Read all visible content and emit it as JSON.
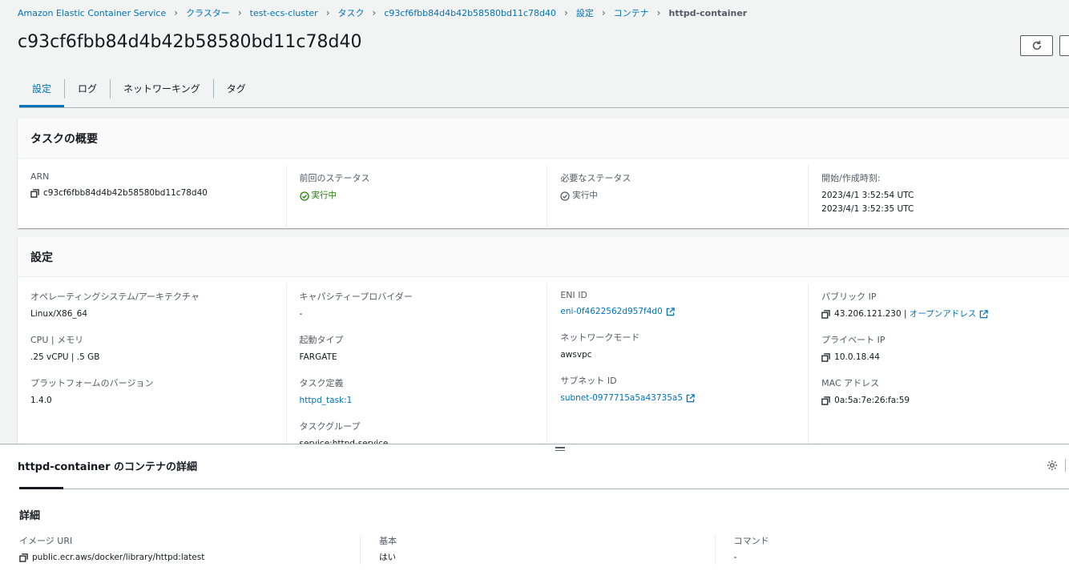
{
  "breadcrumb": {
    "items": [
      "Amazon Elastic Container Service",
      "クラスター",
      "test-ecs-cluster",
      "タスク",
      "c93cf6fbb84d4b42b58580bd11c78d40",
      "設定",
      "コンテナ"
    ],
    "current": "httpd-container"
  },
  "header": {
    "title": "c93cf6fbb84d4b42b58580bd11c78d40"
  },
  "tabs": [
    {
      "label": "設定",
      "active": true
    },
    {
      "label": "ログ"
    },
    {
      "label": "ネットワーキング"
    },
    {
      "label": "タグ"
    }
  ],
  "task_overview": {
    "title": "タスクの概要",
    "arn": {
      "label": "ARN",
      "value": "c93cf6fbb84d4b42b58580bd11c78d40"
    },
    "last_status": {
      "label": "前回のステータス",
      "value": "実行中"
    },
    "desired_status": {
      "label": "必要なステータス",
      "value": "実行中"
    },
    "started_created": {
      "label": "開始/作成時刻:",
      "values": [
        "2023/4/1 3:52:54 UTC",
        "2023/4/1 3:52:35 UTC"
      ]
    }
  },
  "config": {
    "title": "設定",
    "os_arch": {
      "label": "オペレーティングシステム/アーキテクチャ",
      "value": "Linux/X86_64"
    },
    "cpu_mem": {
      "label": "CPU | メモリ",
      "value": ".25 vCPU | .5 GB"
    },
    "platform_version": {
      "label": "プラットフォームのバージョン",
      "value": "1.4.0"
    },
    "capacity_provider": {
      "label": "キャパシティープロバイダー",
      "value": "-"
    },
    "launch_type": {
      "label": "起動タイプ",
      "value": "FARGATE"
    },
    "task_definition": {
      "label": "タスク定義",
      "value": "httpd_task:1"
    },
    "task_group": {
      "label": "タスクグループ",
      "value": "service:httpd-service"
    },
    "eni_id": {
      "label": "ENI ID",
      "value": "eni-0f4622562d957f4d0"
    },
    "network_mode": {
      "label": "ネットワークモード",
      "value": "awsvpc"
    },
    "subnet_id": {
      "label": "サブネット ID",
      "value": "subnet-0977715a5a43735a5"
    },
    "public_ip": {
      "label": "パブリック IP",
      "value": "43.206.121.230 |",
      "link": "オープンアドレス"
    },
    "private_ip": {
      "label": "プライベート IP",
      "value": "10.0.18.44"
    },
    "mac": {
      "label": "MAC アドレス",
      "value": "0a:5a:7e:26:fa:59"
    }
  },
  "container_details": {
    "title": "httpd-container のコンテナの詳細",
    "section": "詳細",
    "image_uri": {
      "label": "イメージ URI",
      "value": "public.ecr.aws/docker/library/httpd:latest"
    },
    "essential": {
      "label": "基本",
      "value": "はい"
    },
    "command": {
      "label": "コマンド",
      "value": "-"
    }
  },
  "icons": {
    "copy": "copy-icon",
    "status_ok": "status-success-icon",
    "external": "external-link-icon",
    "refresh": "refresh-icon",
    "settings": "settings-icon"
  },
  "colors": {
    "link": "#0073bb",
    "success": "#1d8102",
    "text": "#16191f",
    "secondary": "#545b64"
  }
}
